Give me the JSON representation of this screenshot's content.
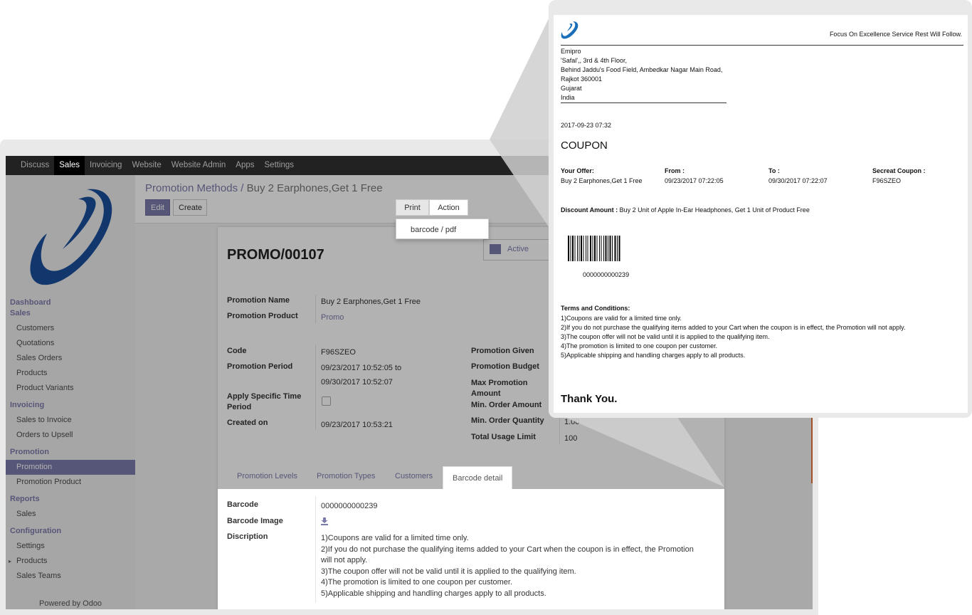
{
  "topbar": {
    "items": [
      "Discuss",
      "Sales",
      "Invoicing",
      "Website",
      "Website Admin",
      "Apps",
      "Settings"
    ],
    "active": "Sales"
  },
  "sidebar": {
    "sections": [
      {
        "title": "Dashboard",
        "items": []
      },
      {
        "title": "Sales",
        "items": [
          "Customers",
          "Quotations",
          "Sales Orders",
          "Products",
          "Product Variants"
        ]
      },
      {
        "title": "Invoicing",
        "items": [
          "Sales to Invoice",
          "Orders to Upsell"
        ]
      },
      {
        "title": "Promotion",
        "items": [
          "Promotion",
          "Promotion Product"
        ]
      },
      {
        "title": "Reports",
        "items": [
          "Sales"
        ]
      },
      {
        "title": "Configuration",
        "items": [
          "Settings",
          "Products",
          "Sales Teams"
        ]
      }
    ],
    "selected": "Promotion",
    "powered": "Powered by Odoo"
  },
  "breadcrumb": {
    "parent": "Promotion Methods",
    "sep": "/",
    "current": "Buy 2 Earphones,Get 1 Free"
  },
  "buttons": {
    "edit": "Edit",
    "create": "Create",
    "print": "Print",
    "action": "Action"
  },
  "print_menu": {
    "items": [
      "barcode / pdf"
    ]
  },
  "form": {
    "title": "PROMO/00107",
    "active_label": "Active",
    "promotion_name_label": "Promotion Name",
    "promotion_name": "Buy 2 Earphones,Get 1 Free",
    "promotion_product_label": "Promotion Product",
    "promotion_product": "Promo",
    "code_label": "Code",
    "code": "F96SZEO",
    "period_label": "Promotion Period",
    "period_from": "09/23/2017 10:52:05 to",
    "period_to": "09/30/2017 10:52:07",
    "specific_time_label": "Apply Specific Time Period",
    "created_label": "Created on",
    "created": "09/23/2017 10:53:21",
    "given_label": "Promotion Given",
    "budget_label": "Promotion Budget",
    "max_amount_label": "Max Promotion Amount",
    "min_amount_label": "Min. Order Amount",
    "min_qty_label": "Min. Order Quantity",
    "min_qty": "1.00",
    "usage_label": "Total Usage Limit",
    "usage": "100",
    "tabs": [
      "Promotion Levels",
      "Promotion Types",
      "Customers",
      "Barcode detail"
    ],
    "active_tab": "Barcode detail",
    "barcode_label": "Barcode",
    "barcode": "0000000000239",
    "barcode_image_label": "Barcode Image",
    "description_label": "Discription",
    "description_lines": [
      "1)Coupons are valid for a limited time only.",
      "2)If you do not purchase the qualifying items added to your Cart when the coupon is in effect, the Promotion",
      "will not apply.",
      "3)The coupon offer will not be valid until it is applied to the qualifying item.",
      "4)The promotion is limited to one coupon per customer.",
      "5)Applicable shipping and handling charges apply to all products."
    ]
  },
  "coupon": {
    "tagline": "Focus On Excellence Service Rest Will Follow.",
    "address": [
      "Emipro",
      "'Safal',, 3rd & 4th Floor,",
      "Behind Jaddu's Food Field, Ambedkar Nagar Main Road,",
      "Rajkot 360001",
      "Gujarat",
      "India"
    ],
    "date": "2017-09-23 07:32",
    "heading": "COUPON",
    "offer_label": "Your Offer:",
    "offer": "Buy 2 Earphones,Get 1 Free",
    "from_label": "From :",
    "from": "09/23/2017 07:22:05",
    "to_label": "To :",
    "to": "09/30/2017 07:22:07",
    "secret_label": "Secreat Coupon :",
    "secret": "F96SZEO",
    "discount_label": "Discount Amount :",
    "discount": "Buy 2 Unit of Apple In-Ear Headphones, Get 1 Unit of Product Free",
    "barcode_number": "0000000000239",
    "terms_title": "Terms and Conditions:",
    "terms": [
      "1)Coupons are valid for a limited time only.",
      "2)If you do not purchase the qualifying items added to your Cart when the coupon is in effect, the Promotion will not apply.",
      "3)The coupon offer will not be valid until it is applied to the qualifying item.",
      "4)The promotion is limited to one coupon per customer.",
      "5)Applicable shipping and handling charges apply to all products."
    ],
    "thanks": "Thank You."
  },
  "colors": {
    "accent": "#7c7bad",
    "topbar": "#222222",
    "logo_blue": "#1a4f9c"
  }
}
